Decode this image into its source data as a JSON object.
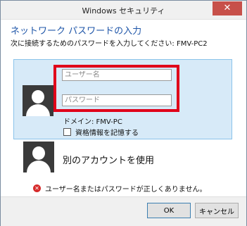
{
  "window": {
    "title": "Windows セキュリティ",
    "close_icon": "close-icon"
  },
  "header": {
    "title": "ネットワーク パスワードの入力",
    "subtitle": "次に接続するためのパスワードを入力してください: FMV-PC2"
  },
  "credentials": {
    "username_placeholder": "ユーザー名",
    "password_placeholder": "パスワード",
    "domain": "ドメイン: FMV-PC",
    "remember_label": "資格情報を記憶する",
    "remember_checked": false
  },
  "other_account": {
    "label": "別のアカウントを使用"
  },
  "error": {
    "icon": "error-icon",
    "icon_glyph": "✕",
    "message": "ユーザー名またはパスワードが正しくありません。"
  },
  "buttons": {
    "ok": "OK",
    "cancel": "キャンセル"
  },
  "colors": {
    "highlight_border": "#e0001a",
    "selected_panel": "#d7eaf8",
    "title_link": "#1e55a8",
    "close_button": "#c7504a"
  }
}
